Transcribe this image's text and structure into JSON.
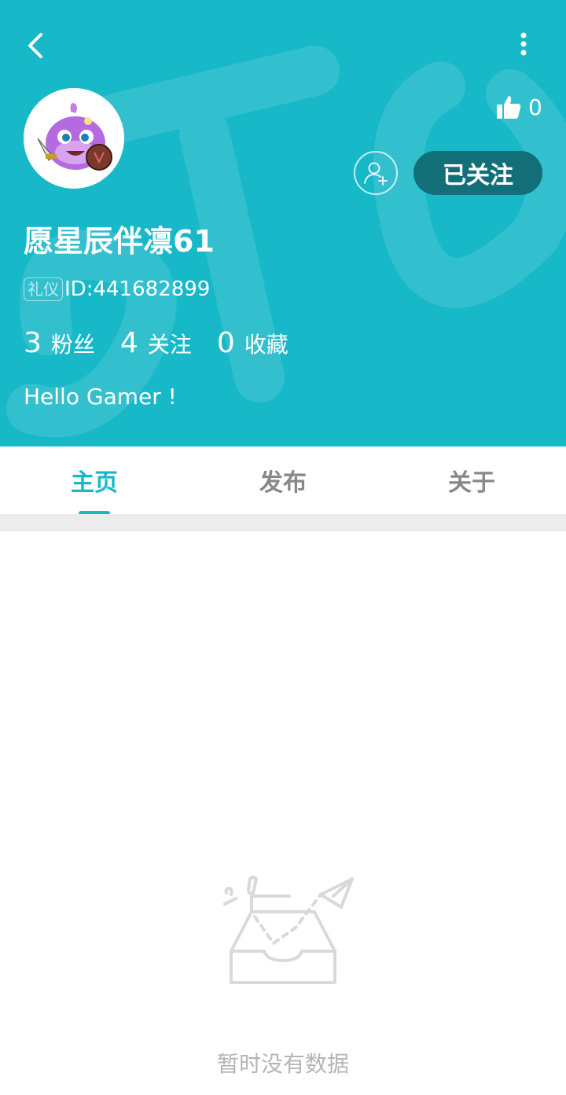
{
  "colors": {
    "accent": "#17b8c8",
    "follow_button_bg": "#126f78",
    "divider": "#ececec"
  },
  "header": {
    "back_icon": "chevron-left-icon",
    "more_icon": "vertical-dots-icon",
    "like_count": "0",
    "user": {
      "name": "愿星辰伴凛61",
      "badge": "礼仪",
      "id_text": "ID:441682899",
      "bio": "Hello Gamer !"
    },
    "stats": [
      {
        "value": "3",
        "label": "粉丝"
      },
      {
        "value": "4",
        "label": "关注"
      },
      {
        "value": "0",
        "label": "收藏"
      }
    ],
    "follow_label": "已关注"
  },
  "tabs": [
    {
      "label": "主页",
      "active": true
    },
    {
      "label": "发布",
      "active": false
    },
    {
      "label": "关于",
      "active": false
    }
  ],
  "empty_state": {
    "icon": "empty-inbox-icon",
    "text": "暂时没有数据"
  }
}
